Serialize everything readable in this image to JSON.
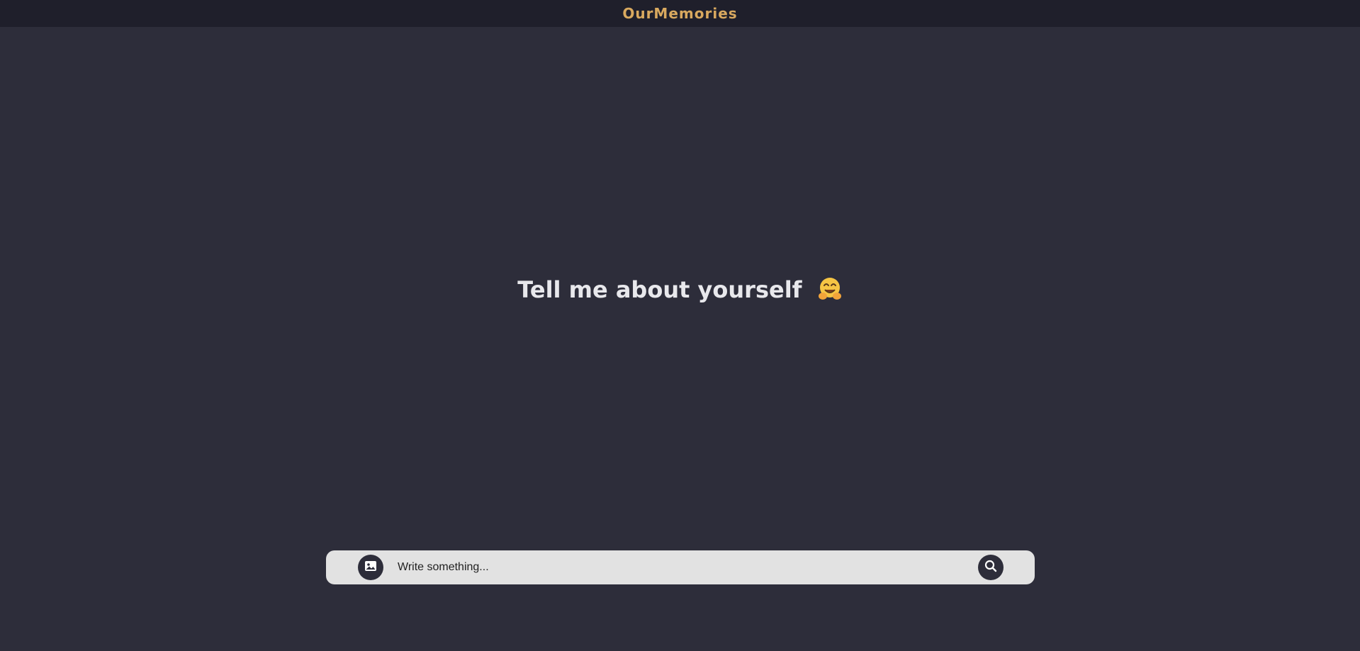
{
  "header": {
    "brand": "OurMemories"
  },
  "main": {
    "prompt": "Tell me about yourself",
    "prompt_emoji": "hugging-face-emoji"
  },
  "composer": {
    "placeholder": "Write something...",
    "value": "",
    "image_icon": "image-icon",
    "search_icon": "search-icon"
  },
  "colors": {
    "background": "#2d2d3a",
    "topbar": "#1f1f2b",
    "brand": "#d9a95f",
    "composer": "#e2e2e2",
    "title": "#e8e8ec"
  }
}
